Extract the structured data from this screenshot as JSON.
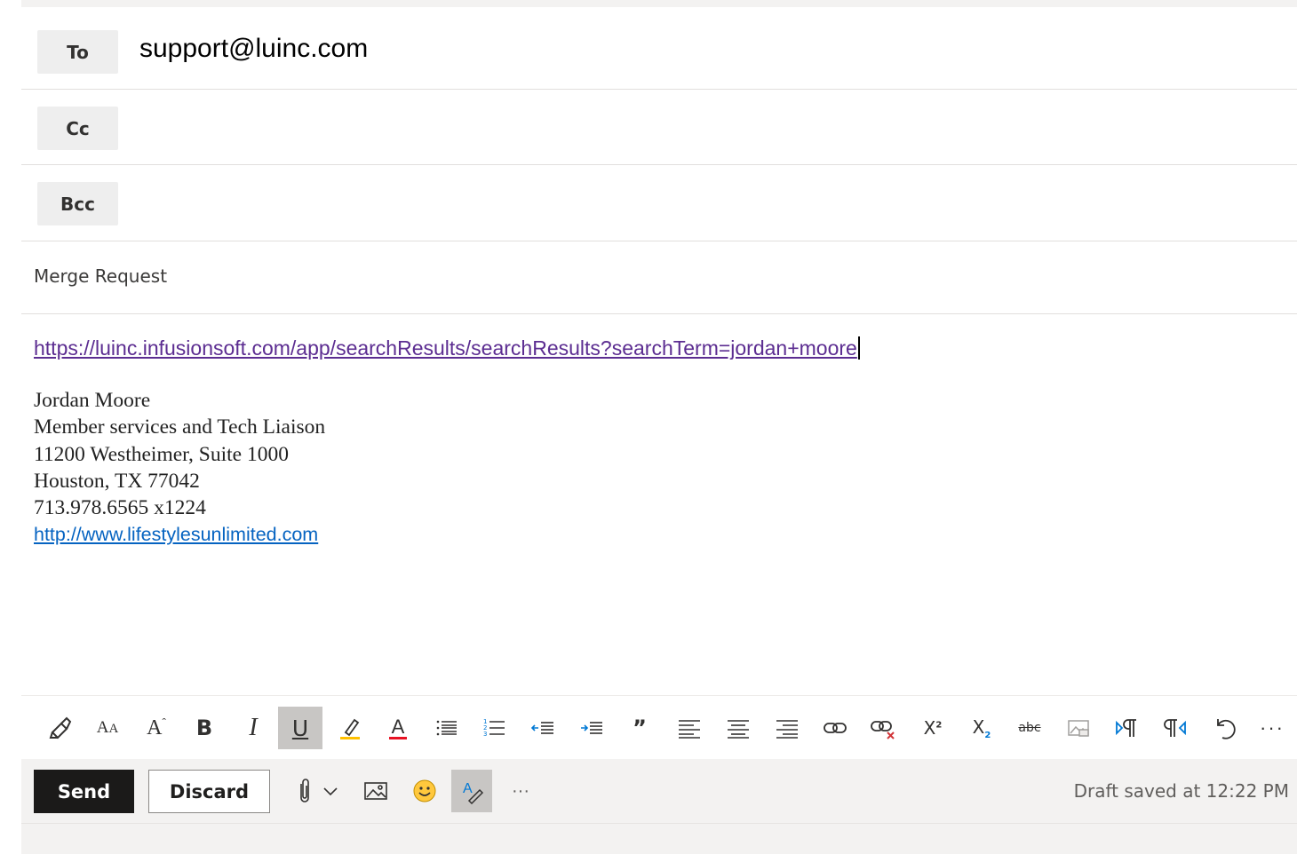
{
  "recipients": {
    "to": {
      "label": "To",
      "value": "support@luinc.com"
    },
    "cc": {
      "label": "Cc",
      "value": ""
    },
    "bcc": {
      "label": "Bcc",
      "value": ""
    }
  },
  "subject": "Merge Request",
  "body": {
    "link": "https://luinc.infusionsoft.com/app/searchResults/searchResults?searchTerm=jordan+moore",
    "signature": {
      "name": "Jordan Moore",
      "title": "Member services and Tech Liaison",
      "address1": "11200 Westheimer, Suite 1000",
      "address2": "Houston, TX 77042",
      "phone": "713.978.6565 x1224",
      "website": "http://www.lifestylesunlimited.com"
    }
  },
  "format_toolbar": {
    "items": [
      "format-painter-icon",
      "font-size-icon",
      "grow-font-icon",
      "bold-icon",
      "italic-icon",
      "underline-icon",
      "highlight-icon",
      "font-color-icon",
      "bullets-icon",
      "numbering-icon",
      "decrease-indent-icon",
      "increase-indent-icon",
      "quote-icon",
      "align-left-icon",
      "align-center-icon",
      "align-right-icon",
      "insert-link-icon",
      "remove-link-icon",
      "superscript-icon",
      "subscript-icon",
      "strikethrough-icon",
      "picture-placeholder-icon",
      "ltr-icon",
      "rtl-icon",
      "undo-icon",
      "more-options-icon"
    ],
    "active": "underline-icon",
    "colors": {
      "highlight": "#ffc000",
      "font_color": "#e81123",
      "active_bg": "#c8c6c4"
    }
  },
  "actions": {
    "send_label": "Send",
    "discard_label": "Discard",
    "draft_status": "Draft saved at 12:22 PM",
    "more_label": "···"
  },
  "colors": {
    "send_bg": "#1b1a19",
    "link_visited": "#5c2d91",
    "link": "#0563c1"
  }
}
